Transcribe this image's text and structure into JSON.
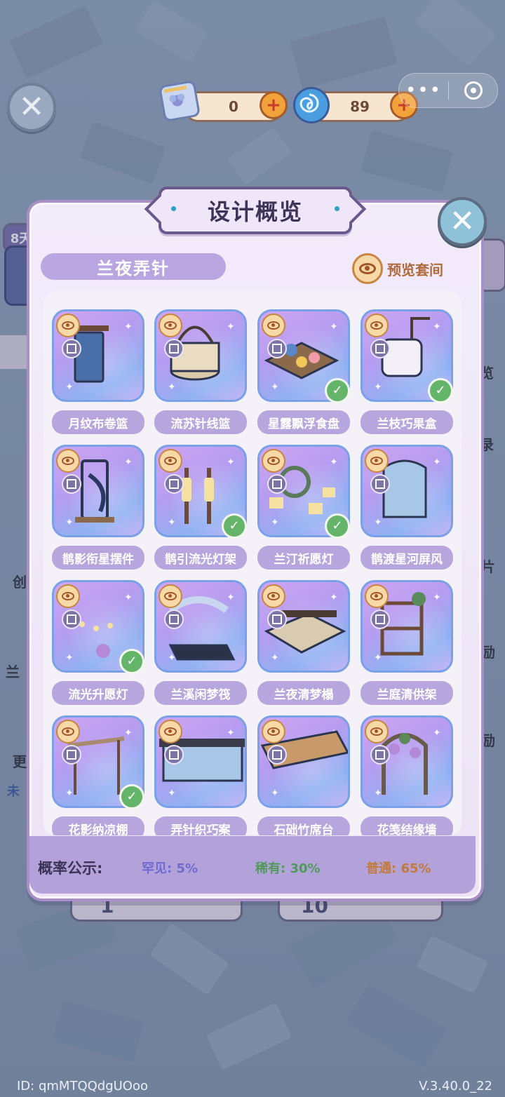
{
  "currency": {
    "tickets": "0",
    "gems": "89"
  },
  "panel": {
    "title": "设计概览",
    "set_name": "兰夜弄针",
    "preview_label": "预览套间"
  },
  "items": [
    {
      "name": "月纹布卷篮",
      "owned": false
    },
    {
      "name": "流苏针线篮",
      "owned": false
    },
    {
      "name": "星露飘浮食盘",
      "owned": true
    },
    {
      "name": "兰枝巧果盒",
      "owned": true
    },
    {
      "name": "鹊影衔星摆件",
      "owned": false
    },
    {
      "name": "鹊引流光灯架",
      "owned": true
    },
    {
      "name": "兰汀祈愿灯",
      "owned": true
    },
    {
      "name": "鹊渡星河屏风",
      "owned": false
    },
    {
      "name": "流光升愿灯",
      "owned": true
    },
    {
      "name": "兰溪闲梦筏",
      "owned": false
    },
    {
      "name": "兰夜清梦榻",
      "owned": false
    },
    {
      "name": "兰庭清供架",
      "owned": false
    },
    {
      "name": "花影纳凉棚",
      "owned": true
    },
    {
      "name": "弄针织巧案",
      "owned": false
    },
    {
      "name": "石础竹席台",
      "owned": false
    },
    {
      "name": "花笺结缘墙",
      "owned": false
    }
  ],
  "probability": {
    "label": "概率公示:",
    "rare": "罕见: 5%",
    "uncommon": "稀有: 30%",
    "common": "普通: 65%",
    "colors": {
      "rare": "#6f6ad0",
      "uncommon": "#4f9a5a",
      "common": "#c27a3a"
    }
  },
  "background": {
    "badge": "8天",
    "side_labels": [
      "览",
      "录",
      "片",
      "励",
      "励"
    ],
    "left_labels": [
      "创",
      "兰",
      "更",
      "未"
    ],
    "bottom_numbers": [
      "1",
      "10"
    ]
  },
  "footer": {
    "id": "ID: qmMTQQdgUOoo",
    "version": "V.3.40.0_22"
  }
}
